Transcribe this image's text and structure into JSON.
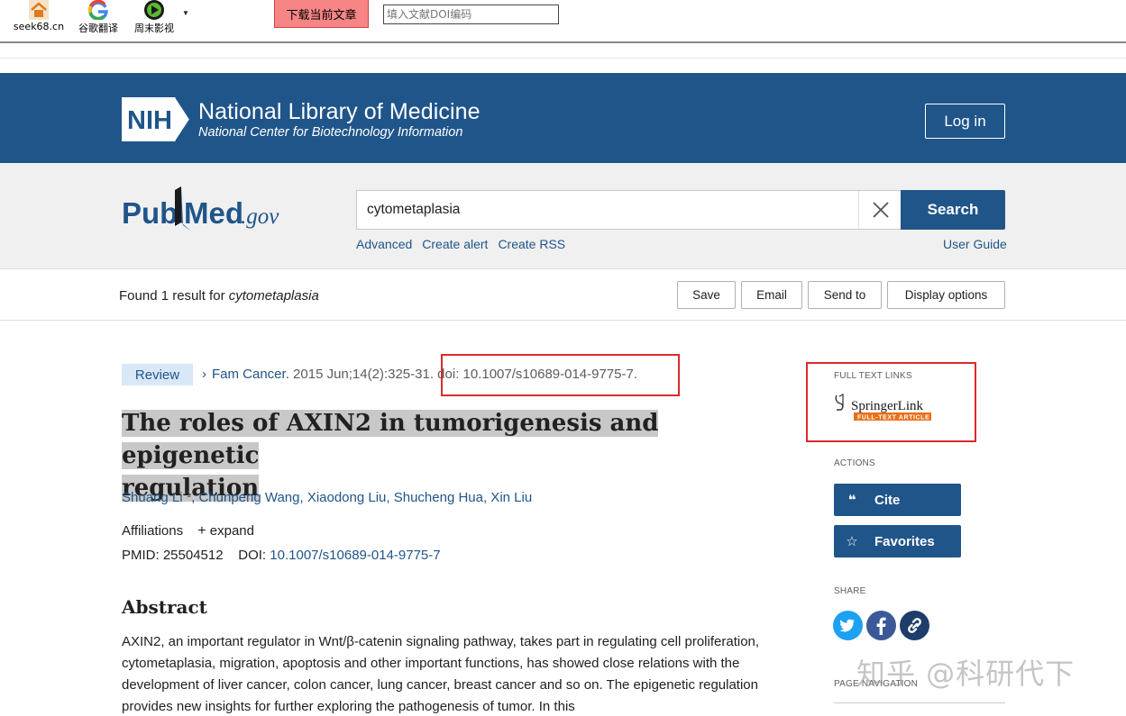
{
  "browser_toolbar": {
    "items": [
      {
        "label": "seek68.cn",
        "icon": "home-icon"
      },
      {
        "label": "谷歌翻译",
        "icon": "google-icon"
      },
      {
        "label": "周末影视",
        "icon": "play-icon"
      }
    ],
    "download_button": "下载当前文章",
    "doi_input_placeholder": "填入文献DOI编码"
  },
  "header": {
    "nih_badge": "NIH",
    "title": "National Library of Medicine",
    "subtitle": "National Center for Biotechnology Information",
    "login": "Log in"
  },
  "search": {
    "logo_pub": "Pub",
    "logo_med": "Med",
    "logo_gov": ".gov",
    "query": "cytometaplasia",
    "button": "Search",
    "links": [
      "Advanced",
      "Create alert",
      "Create RSS"
    ],
    "user_guide": "User Guide"
  },
  "results": {
    "found_prefix": "Found 1 result for",
    "found_term": "cytometaplasia",
    "buttons": [
      "Save",
      "Email",
      "Send to",
      "Display options"
    ]
  },
  "article": {
    "badge": "Review",
    "journal": "Fam Cancer.",
    "citation": "2015 Jun;14(2):325-31.",
    "doi_citation": "doi: 10.1007/s10689-014-9775-7.",
    "title_line1": "The roles of AXIN2 in tumorigenesis and epigenetic",
    "title_line2": "regulation",
    "authors": {
      "first": "Shuang Li",
      "first_sup": "1",
      "rest": ", Chunpeng Wang, Xiaodong Liu, Shucheng Hua, Xin Liu"
    },
    "affiliations_label": "Affiliations",
    "expand": "expand",
    "pmid_label": "PMID:",
    "pmid": "25504512",
    "doi_label": "DOI:",
    "doi": "10.1007/s10689-014-9775-7",
    "abstract_heading": "Abstract",
    "abstract_text": "AXIN2, an important regulator in Wnt/β-catenin signaling pathway, takes part in regulating cell proliferation, cytometaplasia, migration, apoptosis and other important functions, has showed close relations with the development of liver cancer, colon cancer, lung cancer, breast cancer and so on. The epigenetic regulation provides new insights for further exploring the pathogenesis of tumor. In this"
  },
  "sidebar": {
    "full_text_label": "FULL TEXT LINKS",
    "springer_name": "SpringerLink",
    "springer_tag": "FULL-TEXT ARTICLE",
    "actions_label": "ACTIONS",
    "cite": "Cite",
    "favorites": "Favorites",
    "share_label": "SHARE",
    "page_nav_label": "PAGE NAVIGATION"
  },
  "watermark": "知乎 @科研代下",
  "colors": {
    "nih_blue": "#20558a",
    "highlight_red": "#d92b2b",
    "download_button_bg": "#f78585",
    "twitter": "#1da1f2",
    "facebook": "#3b5998"
  }
}
